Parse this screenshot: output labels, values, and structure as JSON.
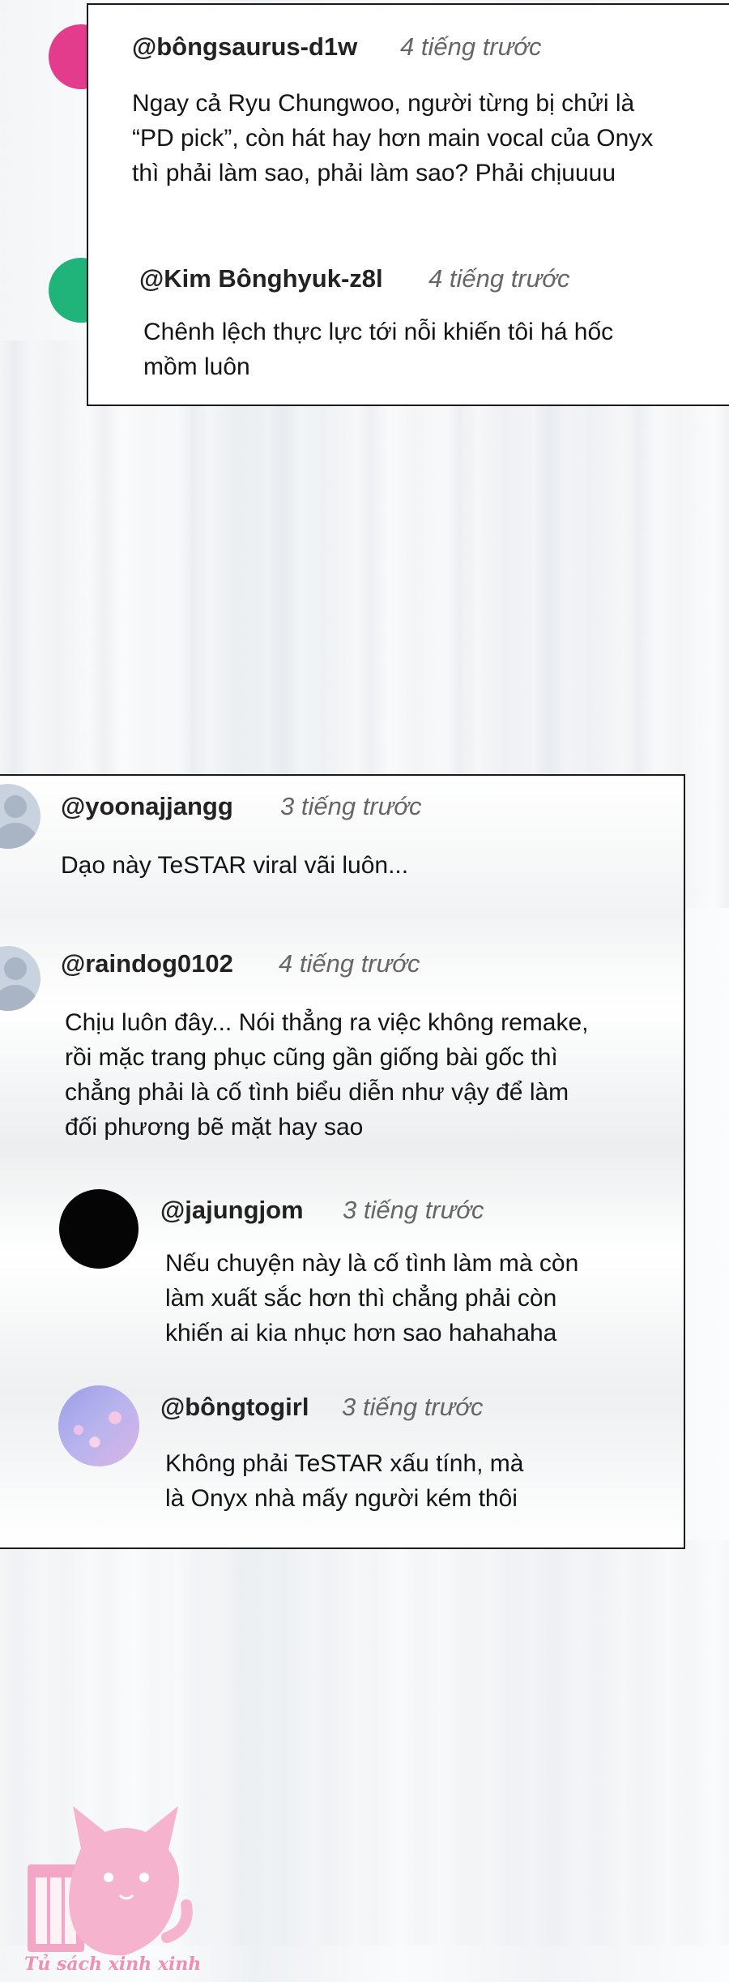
{
  "thread1": {
    "c1": {
      "username": "@bôngsaurus-d1w",
      "time": "4 tiếng trước",
      "lines": [
        "Ngay cả Ryu Chungwoo, người từng bị chửi là",
        "“PD pick”, còn hát hay hơn main vocal của Onyx",
        "thì phải làm sao, phải làm sao? Phải chịuuuu"
      ]
    },
    "c2": {
      "username": "@Kim Bônghyuk-z8l",
      "time": "4 tiếng trước",
      "lines": [
        "Chênh lệch thực lực tới nỗi khiến tôi há hốc",
        "mồm luôn"
      ]
    }
  },
  "thread2": {
    "c1": {
      "username": "@yoonajjangg",
      "time": "3 tiếng trước",
      "lines": [
        "Dạo này TeSTAR viral vãi luôn..."
      ]
    },
    "c2": {
      "username": "@raindog0102",
      "time": "4 tiếng trước",
      "lines": [
        "Chịu luôn đây... Nói thẳng ra việc không remake,",
        "rồi mặc trang phục cũng gần giống bài gốc thì",
        "chẳng phải là cố tình biểu diễn như vậy để làm",
        "đối phương bẽ mặt hay sao"
      ]
    },
    "c3": {
      "username": "@jajungjom",
      "time": "3 tiếng trước",
      "lines": [
        "Nếu chuyện này là cố tình làm mà còn",
        "làm xuất sắc hơn thì chẳng phải còn",
        "khiến ai kia nhục hơn sao hahahaha"
      ]
    },
    "c4": {
      "username": "@bôngtogirl",
      "time": "3 tiếng trước",
      "lines": [
        "Không phải TeSTAR xấu tính, mà",
        "là Onyx nhà mấy người kém thôi"
      ]
    }
  },
  "watermark": {
    "text": "Tủ sách xinh xinh"
  },
  "colors": {
    "border": "#1b1b1b",
    "avatar_pink": "#e43c8c",
    "avatar_green": "#20b37a",
    "watermark": "#f08fb5"
  }
}
